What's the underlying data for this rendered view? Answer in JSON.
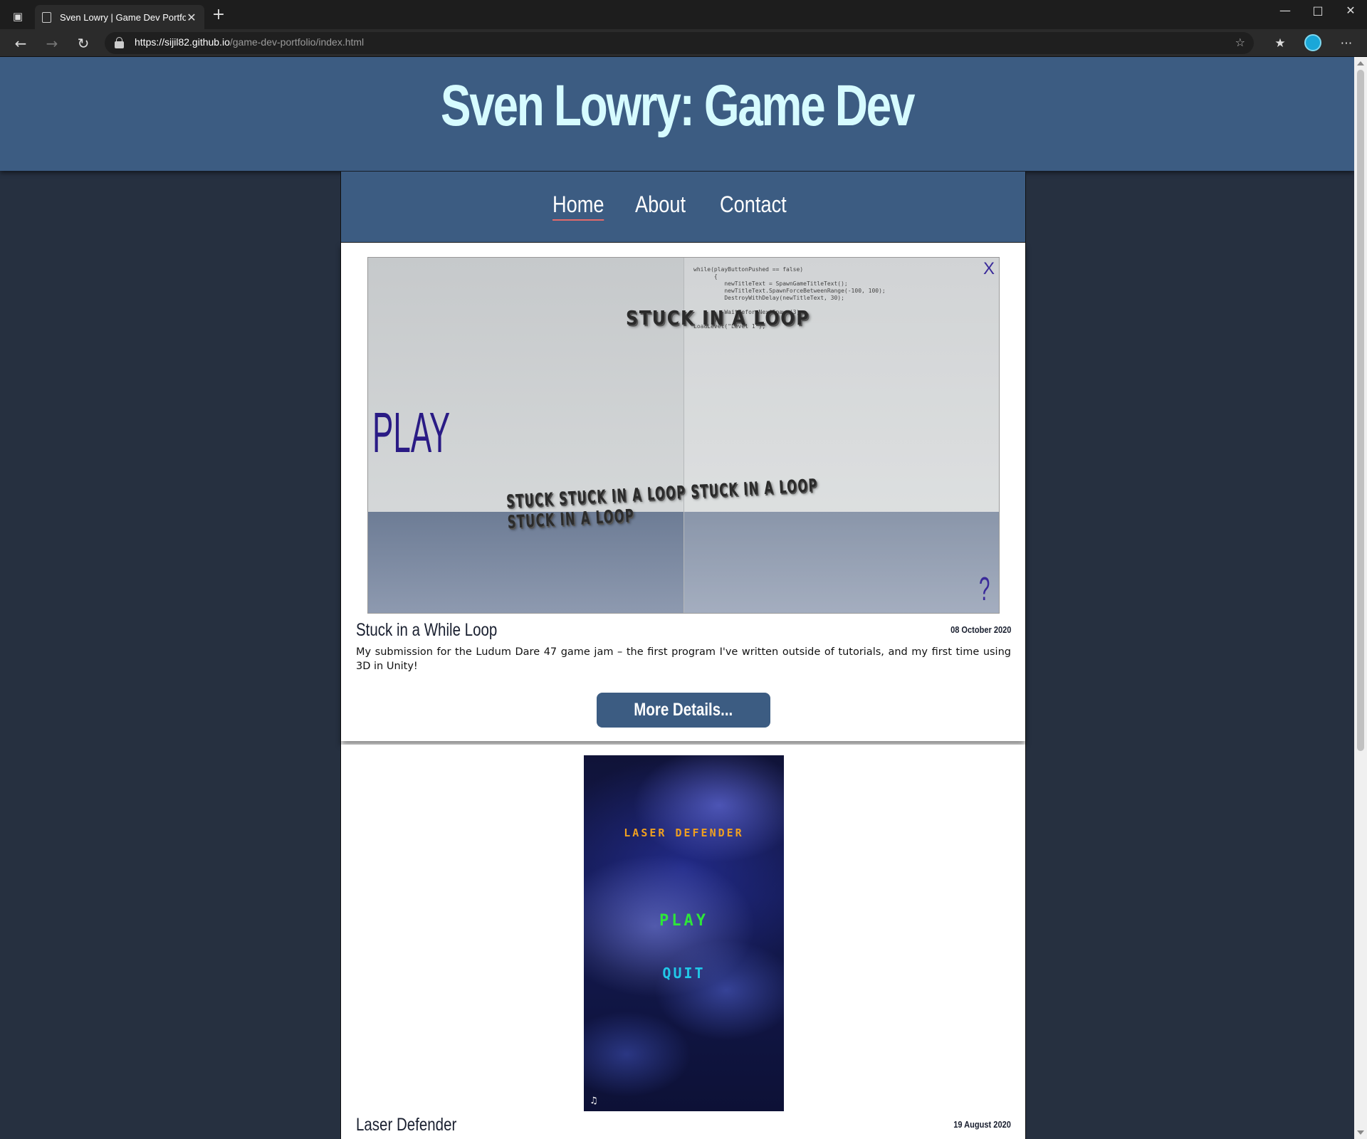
{
  "browser": {
    "tab_title": "Sven Lowry | Game Dev Portfolio",
    "url_host": "https://sijil82.github.io",
    "url_path": "/game-dev-portfolio/index.html"
  },
  "site": {
    "title": "Sven Lowry: Game Dev",
    "nav": [
      "Home",
      "About",
      "Contact"
    ],
    "colors": {
      "header": "#3c5c82",
      "title": "#d6fbff",
      "background": "#263040"
    }
  },
  "posts": [
    {
      "title": "Stuck in a While Loop",
      "date": "08 October 2020",
      "description": "My submission for the Ludum Dare 47 game jam – the first program I've written outside of tutorials, and my first time using 3D in Unity!",
      "button": "More Details...",
      "screenshot": {
        "play": "PLAY",
        "close": "X",
        "help": "?",
        "code": "while(playButtonPushed == false)\n      {\n         newTitleText = SpawnGameTitleText();\n         newTitleText.SpawnForceBetweenRange(-100, 100);\n         DestroyWithDelay(newTitleText, 30);\n\n         WaitBeforeNextSpawn(3);\n      }\nLoadLevel(\"Level 1\");",
        "title_text_top": "STUCK IN A LOOP",
        "title_text_pile": "STUCK STUCK IN A LOOP STUCK IN A LOOP STUCK IN A LOOP"
      }
    },
    {
      "title": "Laser Defender",
      "date": "19 August 2020",
      "screenshot": {
        "title": "LASER DEFENDER",
        "play": "PLAY",
        "quit": "QUIT",
        "music_icon": "music-note-icon"
      }
    }
  ]
}
